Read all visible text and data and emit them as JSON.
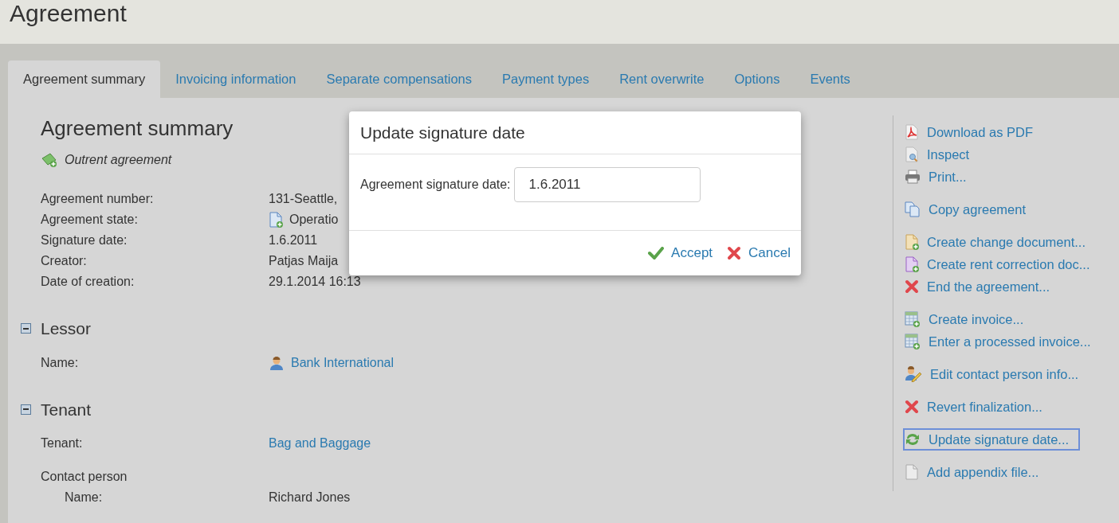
{
  "page": {
    "title": "Agreement"
  },
  "tabs": [
    {
      "label": "Agreement summary",
      "selected": true
    },
    {
      "label": "Invoicing information",
      "selected": false
    },
    {
      "label": "Separate compensations",
      "selected": false
    },
    {
      "label": "Payment types",
      "selected": false
    },
    {
      "label": "Rent overwrite",
      "selected": false
    },
    {
      "label": "Options",
      "selected": false
    },
    {
      "label": "Events",
      "selected": false
    }
  ],
  "summary": {
    "heading": "Agreement summary",
    "type": "Outrent agreement",
    "fields": [
      {
        "label": "Agreement number:",
        "value": "131-Seattle,"
      },
      {
        "label": "Agreement state:",
        "value": "Operatio",
        "kind": "state"
      },
      {
        "label": "Signature date:",
        "value": "1.6.2011"
      },
      {
        "label": "Creator:",
        "value": "Patjas Maija"
      },
      {
        "label": "Date of creation:",
        "value": "29.1.2014 16:13"
      }
    ]
  },
  "sections": [
    {
      "title": "Lessor",
      "expanded": true,
      "rows": [
        {
          "label": "Name:",
          "value": "Bank International",
          "kind": "person-link"
        }
      ]
    },
    {
      "title": "Tenant",
      "expanded": true,
      "rows": [
        {
          "label": "Tenant:",
          "value": "Bag and Baggage",
          "kind": "link"
        },
        {
          "label": "Contact person",
          "kind": "subheading"
        },
        {
          "label": "Name:",
          "value": "Richard Jones",
          "kind": "sub"
        }
      ]
    }
  ],
  "actions": [
    [
      {
        "label": "Download as PDF",
        "kind": "pdf",
        "selected": false
      },
      {
        "label": "Inspect",
        "kind": "inspect",
        "selected": false
      },
      {
        "label": "Print...",
        "kind": "print",
        "selected": false
      }
    ],
    [
      {
        "label": "Copy agreement",
        "kind": "copy",
        "selected": false
      }
    ],
    [
      {
        "label": "Create change document...",
        "kind": "change-doc",
        "selected": false
      },
      {
        "label": "Create rent correction doc...",
        "kind": "correction-doc",
        "selected": false
      },
      {
        "label": "End the agreement...",
        "kind": "delete",
        "selected": false
      }
    ],
    [
      {
        "label": "Create invoice...",
        "kind": "invoice",
        "selected": false
      },
      {
        "label": "Enter a processed invoice...",
        "kind": "invoice",
        "selected": false
      }
    ],
    [
      {
        "label": "Edit contact person info...",
        "kind": "contact",
        "selected": false
      }
    ],
    [
      {
        "label": "Revert finalization...",
        "kind": "delete",
        "selected": false
      }
    ],
    [
      {
        "label": "Update signature date...",
        "kind": "refresh",
        "selected": true
      }
    ],
    [
      {
        "label": "Add appendix file...",
        "kind": "file",
        "selected": false
      }
    ]
  ],
  "dialog": {
    "title": "Update signature date",
    "field_label": "Agreement signature date:",
    "field_value": "1.6.2011",
    "buttons": [
      {
        "label": "Accept",
        "kind": "accept"
      },
      {
        "label": "Cancel",
        "kind": "cancel"
      }
    ]
  }
}
